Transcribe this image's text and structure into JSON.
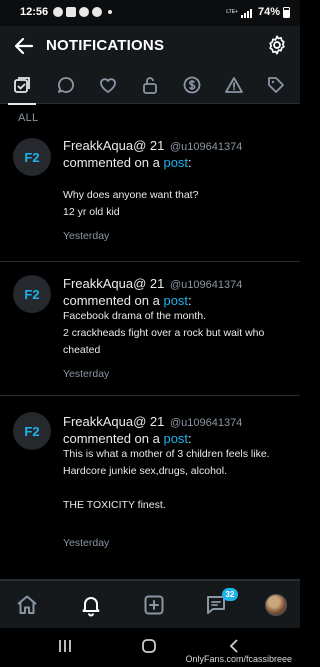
{
  "status_bar": {
    "time": "12:56",
    "network": "LTE+",
    "battery": "74%"
  },
  "header": {
    "title": "NOTIFICATIONS"
  },
  "tabs": [
    "all-tab",
    "comments-tab",
    "favorites-tab",
    "subscriptions-tab",
    "tips-tab",
    "alerts-tab",
    "promotions-tab"
  ],
  "filter_label": "ALL",
  "notifications": [
    {
      "avatar": "F2",
      "name": "FreakkAqua@ 21",
      "username": "@u109641374",
      "action_prefix": "commented on a",
      "action_link": "post",
      "action_suffix": ":",
      "message": "Why does anyone want that?\n12 yr old kid",
      "time": "Yesterday"
    },
    {
      "avatar": "F2",
      "name": "FreakkAqua@ 21",
      "username": "@u109641374",
      "action_prefix": "commented on a",
      "action_link": "post",
      "action_suffix": ":",
      "message": "Facebook drama of the month.\n2 crackheads fight over a rock but wait who cheated",
      "time": "Yesterday"
    },
    {
      "avatar": "F2",
      "name": "FreakkAqua@ 21",
      "username": "@u109641374",
      "action_prefix": "commented on a",
      "action_link": "post",
      "action_suffix": ":",
      "message": "This is what a mother of 3 children feels like. Hardcore junkie sex,drugs, alcohol.\n\nTHE TOXICITY finest.",
      "time": "Yesterday"
    }
  ],
  "bottom_nav": {
    "messages_badge": "32"
  },
  "watermark": "OnlyFans.com/fcassibreee",
  "colors": {
    "accent": "#1fb2ea",
    "background": "#000000",
    "header": "#16191c",
    "muted": "#8a96a3"
  }
}
